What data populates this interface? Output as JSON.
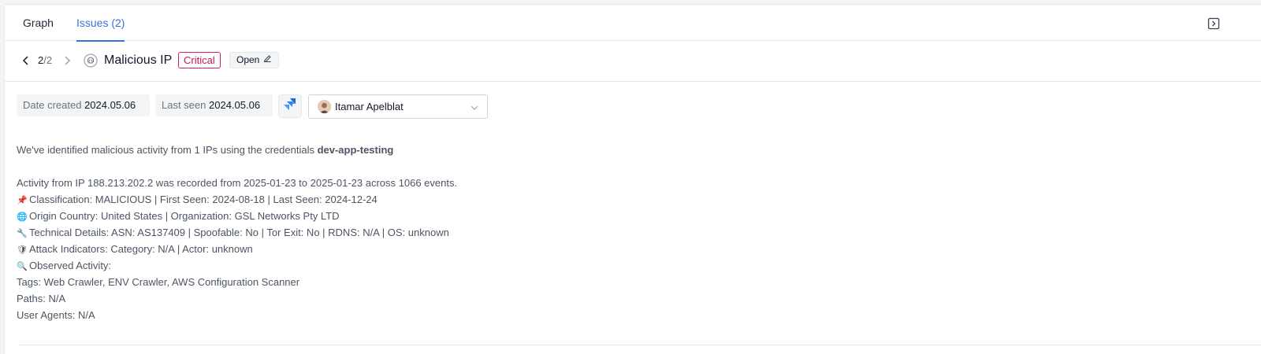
{
  "tabs": {
    "graph": "Graph",
    "issues": "Issues (2)"
  },
  "icons": {
    "panel_toggle": "panel-collapse-icon",
    "prev": "chevron-left-icon",
    "next": "chevron-right-icon",
    "issue_type": "skull-icon",
    "edit": "pencil-icon",
    "jira": "jira-icon",
    "assignee_dropdown": "chevron-down-icon"
  },
  "header": {
    "nav_current": "2",
    "nav_total": "/2",
    "title": "Malicious IP",
    "severity": "Critical",
    "status": "Open"
  },
  "meta": {
    "created_label": "Date created",
    "created_value": "2024.05.06",
    "seen_label": "Last seen",
    "seen_value": "2024.05.06",
    "assignee": "Itamar Apelblat"
  },
  "description": {
    "intro": "We've identified malicious activity from 1 IPs using the credentials ",
    "credential": "dev-app-testing",
    "activity": "Activity from IP 188.213.202.2 was recorded from 2025-01-23 to 2025-01-23 across 1066 events.",
    "classification": "Classification: MALICIOUS | First Seen: 2024-08-18 | Last Seen: 2024-12-24",
    "origin": "Origin Country: United States | Organization: GSL Networks Pty LTD",
    "technical": "Technical Details: ASN: AS137409 | Spoofable: No | Tor Exit: No | RDNS: N/A | OS: unknown",
    "attack": "Attack Indicators: Category: N/A | Actor: unknown",
    "observed": "Observed Activity:",
    "tags": "Tags: Web Crawler, ENV Crawler, AWS Configuration Scanner",
    "paths": "Paths: N/A",
    "user_agents": "User Agents: N/A"
  },
  "colors": {
    "accent": "#3b6fe0",
    "critical": "#c2185b",
    "jira": "#2684ff"
  }
}
